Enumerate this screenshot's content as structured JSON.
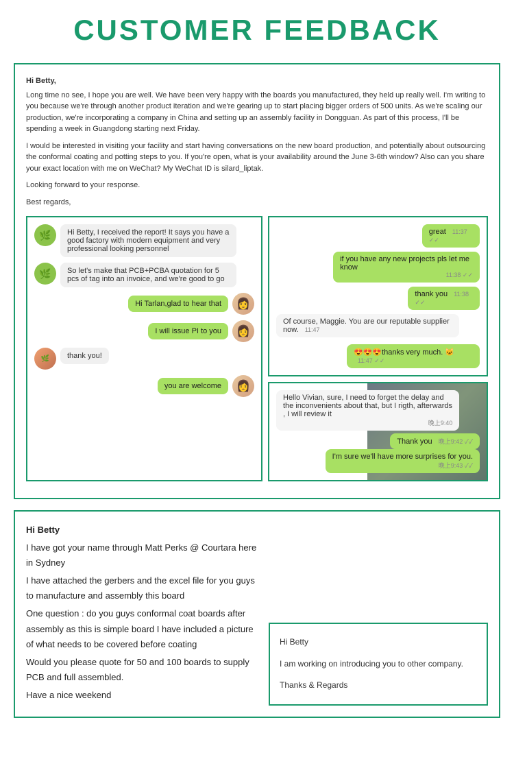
{
  "page": {
    "title": "CUSTOMER FEEDBACK"
  },
  "email_top": {
    "greeting": "Hi Betty,",
    "paragraph1": "Long time no see, I hope you are well. We have been very happy with the boards you manufactured, they held up really well. I'm writing to you because we're through another product iteration and we're gearing up to start placing bigger orders of 500 units. As we're scaling our production, we're incorporating a company in China and setting up an assembly facility in Dongguan. As part of this process, I'll be spending a week in Guangdong starting next Friday.",
    "paragraph2": "I would be interested in visiting your facility and start having conversations on the new board production, and potentially about outsourcing the conformal coating and potting steps to you. If you're open, what is your availability around the June 3-6th window? Also can you share your exact location with me on WeChat? My WeChat ID is silard_liptak.",
    "paragraph3": "Looking forward to your response.",
    "closing": "Best regards,"
  },
  "chat_left": {
    "msg1": "Hi Betty, I received the report! It says you have a good factory with modern equipment and very professional looking personnel",
    "msg2": "So let's make that PCB+PCBA quotation for 5 pcs of tag into an invoice, and we're good to go",
    "msg3_sent": "Hi Tarlan,glad to hear that",
    "msg4_sent": "I will issue PI to you",
    "msg5_received": "thank you!",
    "msg6_sent": "you are welcome"
  },
  "chat_right_top": {
    "msg1": "great",
    "ts1": "11:37 ✓✓",
    "msg2": "if you have any new projects pls let me know",
    "ts2": "11:38 ✓✓",
    "msg3": "thank you",
    "ts3": "11:38 ✓✓",
    "msg4": "Of course, Maggie. You are our reputable supplier now.",
    "ts4": "11:47",
    "msg5": "😍😍😍thanks very much. 🐱",
    "ts5": "11:47 ✓✓"
  },
  "chat_right_bottom": {
    "msg1": "Hello Vivian, sure, I need to forget the delay and the inconvenients about that, but I rigth, afterwards , I will review it",
    "ts1": "晚上9:40",
    "msg2": "Thank you",
    "ts2": "晚上9:42 ✓✓",
    "msg3": "I'm sure we'll have more surprises for you.",
    "ts3": "晚上9:43 ✓✓"
  },
  "bottom_email": {
    "line1": "Hi Betty",
    "line2": "I have got your name through Matt Perks @ Courtara here in Sydney",
    "line3": "I have attached the gerbers and the excel file for you guys to manufacture and assembly this board",
    "line4": "One question : do you guys conformal coat boards after assembly as this is simple board I have included a picture of what needs to be covered before coating",
    "line5": "Would you please quote for 50 and 100 boards to supply PCB and full assembled.",
    "line6": "Have a nice weekend"
  },
  "bottom_card": {
    "line1": "Hi Betty",
    "line2": "I am working on introducing you to other company.",
    "line3": "Thanks & Regards"
  }
}
